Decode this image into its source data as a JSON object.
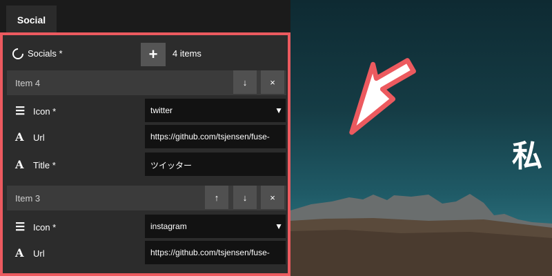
{
  "tab_label": "Social",
  "section": {
    "label": "Socials *",
    "add_label": "+",
    "count": "4 items"
  },
  "items": [
    {
      "title": "Item 4",
      "buttons": [
        "↓",
        "×"
      ],
      "fields": [
        {
          "label": "Icon *",
          "value": "twitter"
        },
        {
          "label": "Url",
          "value": "https://github.com/tsjensen/fuse-"
        },
        {
          "label": "Title *",
          "value": "ツイッター"
        }
      ]
    },
    {
      "title": "Item 3",
      "buttons": [
        "↑",
        "↓",
        "×"
      ],
      "fields": [
        {
          "label": "Icon *",
          "value": "instagram"
        },
        {
          "label": "Url",
          "value": "https://github.com/tsjensen/fuse-"
        }
      ]
    }
  ],
  "hero_text": "私",
  "colors": {
    "highlight": "#ec5a5f",
    "panel": "#2c2c2c",
    "input": "#121212"
  }
}
